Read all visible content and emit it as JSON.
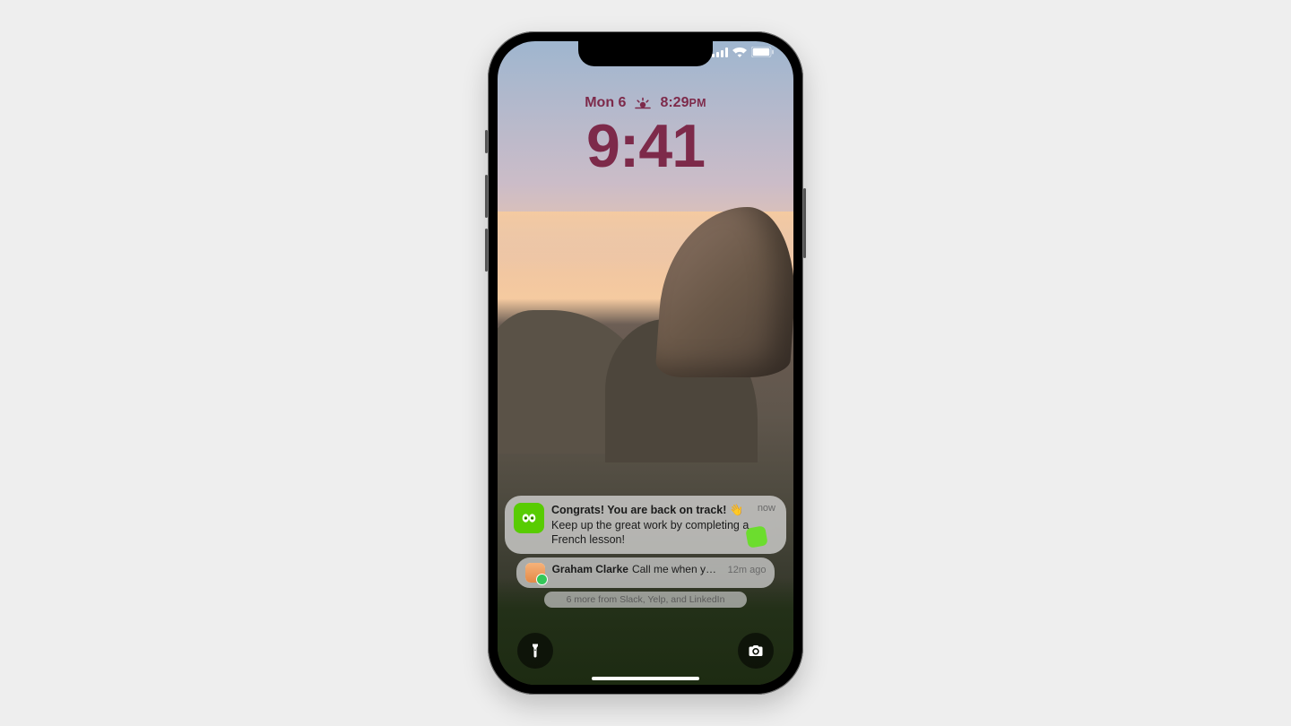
{
  "status": {
    "cell_bars": 4,
    "wifi": true,
    "battery_pct": 95
  },
  "date_row": {
    "day_label": "Mon 6",
    "weather_icon": "sunset-icon",
    "time_label": "8:29",
    "time_suffix": "PM"
  },
  "clock": "9:41",
  "notifications": [
    {
      "app": "Duolingo",
      "icon": "duolingo-icon",
      "title": "Congrats! You are back on track! 👋",
      "body": "Keep up the great work by completing a French lesson!",
      "timestamp": "now"
    },
    {
      "app": "Messages",
      "icon": "contact-avatar",
      "sender": "Graham Clarke",
      "preview": "Call me when y…",
      "timestamp": "12m ago"
    }
  ],
  "stack_summary": "6 more from Slack, Yelp, and LinkedIn",
  "quick_buttons": {
    "left": "flashlight-icon",
    "right": "camera-icon"
  }
}
